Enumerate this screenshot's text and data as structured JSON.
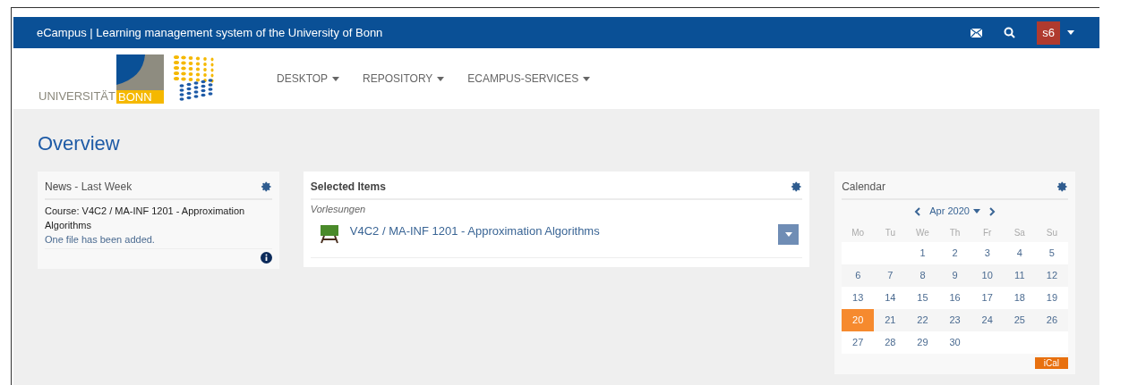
{
  "topbar": {
    "title": "eCampus | Learning management system of the University of Bonn",
    "user": "s6"
  },
  "logo": {
    "text": "UNIVERSITÄT",
    "highlight": "BONN"
  },
  "nav": [
    {
      "label": "DESKTOP"
    },
    {
      "label": "REPOSITORY"
    },
    {
      "label": "ECAMPUS-SERVICES"
    }
  ],
  "page_title": "Overview",
  "news": {
    "title": "News",
    "subtitle": "- Last Week",
    "items": [
      {
        "course": "Course: V4C2 / MA-INF 1201 - Approximation Algorithms",
        "message": "One file has been added."
      }
    ]
  },
  "selected_items": {
    "title": "Selected Items",
    "group": "Vorlesungen",
    "items": [
      {
        "label": "V4C2 / MA-INF 1201 - Approximation Algorithms"
      }
    ]
  },
  "calendar": {
    "title": "Calendar",
    "month": "Apr 2020",
    "weekdays": [
      "Mo",
      "Tu",
      "We",
      "Th",
      "Fr",
      "Sa",
      "Su"
    ],
    "weeks": [
      {
        "days": [
          {
            "day": "1",
            "selected": false
          },
          {
            "day": "2",
            "selected": false
          },
          {
            "day": "3",
            "selected": false
          },
          {
            "day": "4",
            "selected": false
          },
          {
            "day": "5",
            "selected": false
          }
        ]
      },
      {
        "days": [
          {
            "day": "6",
            "selected": false
          },
          {
            "day": "7",
            "selected": false
          },
          {
            "day": "8",
            "selected": false
          },
          {
            "day": "9",
            "selected": false
          },
          {
            "day": "10",
            "selected": false
          },
          {
            "day": "11",
            "selected": false
          },
          {
            "day": "12",
            "selected": false
          }
        ]
      },
      {
        "days": [
          {
            "day": "13",
            "selected": false
          },
          {
            "day": "14",
            "selected": false
          },
          {
            "day": "15",
            "selected": false
          },
          {
            "day": "16",
            "selected": false
          },
          {
            "day": "17",
            "selected": false
          },
          {
            "day": "18",
            "selected": false
          },
          {
            "day": "19",
            "selected": false
          }
        ]
      },
      {
        "days": [
          {
            "day": "20",
            "selected": true
          },
          {
            "day": "21",
            "selected": false
          },
          {
            "day": "22",
            "selected": false
          },
          {
            "day": "23",
            "selected": false
          },
          {
            "day": "24",
            "selected": false
          },
          {
            "day": "25",
            "selected": false
          },
          {
            "day": "26",
            "selected": false
          }
        ]
      },
      {
        "days": [
          {
            "day": "27",
            "selected": false
          },
          {
            "day": "28",
            "selected": false
          },
          {
            "day": "29",
            "selected": false
          },
          {
            "day": "30",
            "selected": false
          }
        ]
      }
    ],
    "export": "iCal"
  }
}
